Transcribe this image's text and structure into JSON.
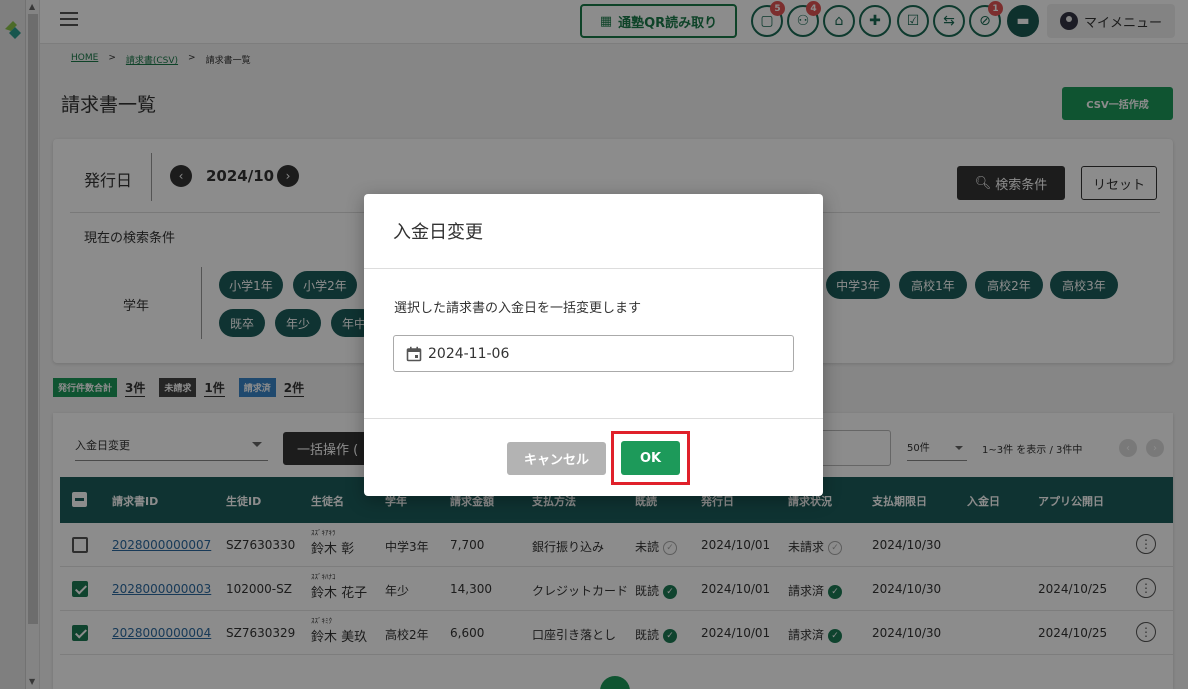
{
  "header": {
    "qr_label": "通塾QR読み取り",
    "badges": {
      "messages": "5",
      "groups": "4",
      "notices": "1"
    },
    "mymenu_label": "マイメニュー"
  },
  "breadcrumb": [
    "HOME",
    "請求書(CSV)",
    "請求書一覧"
  ],
  "page": {
    "title": "請求書一覧",
    "csv_button": "CSV一括作成"
  },
  "search": {
    "issue_label": "発行日",
    "month": "2024/10",
    "search_button": "検索条件",
    "reset_button": "リセット",
    "current_conditions": "現在の検索条件",
    "grade_label": "学年",
    "chips": [
      "小学1年",
      "小学2年",
      "中学3年",
      "高校1年",
      "高校2年",
      "高校3年",
      "既卒",
      "年少",
      "年中"
    ]
  },
  "summary": {
    "total_label": "発行件数合計",
    "total_value": "3件",
    "unbilled_label": "未請求",
    "unbilled_value": "1件",
    "billed_label": "請求済",
    "billed_value": "2件"
  },
  "table_controls": {
    "bulk_select": "入金日変更",
    "bulk_button": "一括操作 (",
    "per_page": "50件",
    "range": "1~3件 を表示 / 3件中"
  },
  "columns": [
    "請求書ID",
    "生徒ID",
    "生徒名",
    "学年",
    "請求金額",
    "支払方法",
    "既読",
    "発行日",
    "請求状況",
    "支払期限日",
    "入金日",
    "アプリ公開日"
  ],
  "rows": [
    {
      "id": "2028000000007",
      "student_id": "SZ7630330",
      "kana": "ｽｽﾞｷｱｷﾗ",
      "name": "鈴木 彰",
      "grade": "中学3年",
      "amount": "7,700",
      "method": "銀行振り込み",
      "read": "未読",
      "issued": "2024/10/01",
      "status": "未請求",
      "due": "2024/10/30",
      "paid": "",
      "published": "",
      "checked": false,
      "read_ok": false,
      "status_ok": false
    },
    {
      "id": "2028000000003",
      "student_id": "102000-SZ",
      "kana": "ｽｽﾞｷﾊﾅｺ",
      "name": "鈴木 花子",
      "grade": "年少",
      "amount": "14,300",
      "method": "クレジットカード",
      "read": "既読",
      "issued": "2024/10/01",
      "status": "請求済",
      "due": "2024/10/30",
      "paid": "",
      "published": "2024/10/25",
      "checked": true,
      "read_ok": true,
      "status_ok": true
    },
    {
      "id": "2028000000004",
      "student_id": "SZ7630329",
      "kana": "ｽｽﾞｷﾐｸ",
      "name": "鈴木 美玖",
      "grade": "高校2年",
      "amount": "6,600",
      "method": "口座引き落とし",
      "read": "既読",
      "issued": "2024/10/01",
      "status": "請求済",
      "due": "2024/10/30",
      "paid": "",
      "published": "2024/10/25",
      "checked": true,
      "read_ok": true,
      "status_ok": true
    }
  ],
  "modal": {
    "title": "入金日変更",
    "message": "選択した請求書の入金日を一括変更します",
    "date_value": "2024-11-06",
    "cancel": "キャンセル",
    "ok": "OK"
  },
  "colors": {
    "brand": "#1d9a5a",
    "dark_teal": "#1d5e5b",
    "highlight": "#e0202a"
  }
}
